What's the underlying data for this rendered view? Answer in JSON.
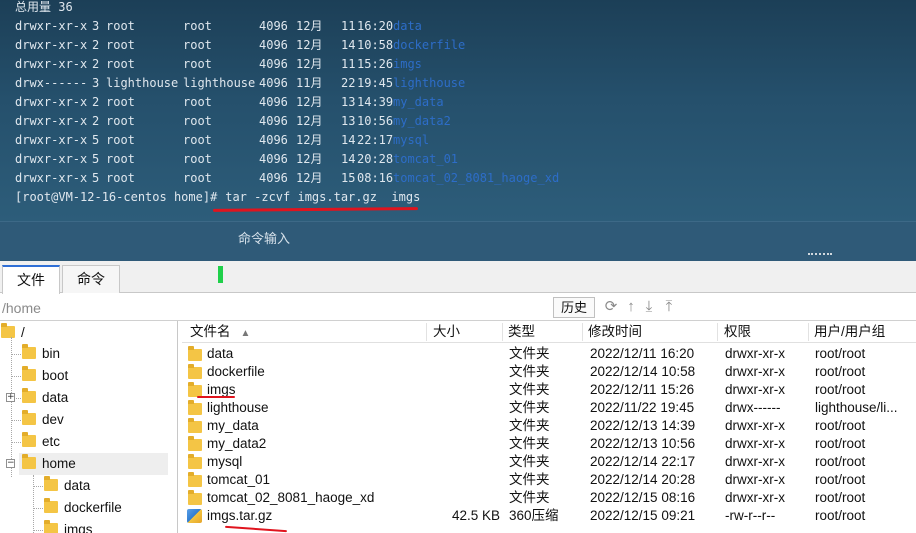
{
  "terminal": {
    "total_line": "总用量 36",
    "rows": [
      {
        "perm": "drwxr-xr-x",
        "links": "3",
        "owner": "root",
        "group": "root",
        "size": "4096",
        "month": "12月",
        "day": "11",
        "time": "16:20",
        "name": "data"
      },
      {
        "perm": "drwxr-xr-x",
        "links": "2",
        "owner": "root",
        "group": "root",
        "size": "4096",
        "month": "12月",
        "day": "14",
        "time": "10:58",
        "name": "dockerfile"
      },
      {
        "perm": "drwxr-xr-x",
        "links": "2",
        "owner": "root",
        "group": "root",
        "size": "4096",
        "month": "12月",
        "day": "11",
        "time": "15:26",
        "name": "imgs"
      },
      {
        "perm": "drwx------",
        "links": "3",
        "owner": "lighthouse",
        "group": "lighthouse",
        "size": "4096",
        "month": "11月",
        "day": "22",
        "time": "19:45",
        "name": "lighthouse"
      },
      {
        "perm": "drwxr-xr-x",
        "links": "2",
        "owner": "root",
        "group": "root",
        "size": "4096",
        "month": "12月",
        "day": "13",
        "time": "14:39",
        "name": "my_data"
      },
      {
        "perm": "drwxr-xr-x",
        "links": "2",
        "owner": "root",
        "group": "root",
        "size": "4096",
        "month": "12月",
        "day": "13",
        "time": "10:56",
        "name": "my_data2"
      },
      {
        "perm": "drwxr-xr-x",
        "links": "5",
        "owner": "root",
        "group": "root",
        "size": "4096",
        "month": "12月",
        "day": "14",
        "time": "22:17",
        "name": "mysql"
      },
      {
        "perm": "drwxr-xr-x",
        "links": "5",
        "owner": "root",
        "group": "root",
        "size": "4096",
        "month": "12月",
        "day": "14",
        "time": "20:28",
        "name": "tomcat_01"
      },
      {
        "perm": "drwxr-xr-x",
        "links": "5",
        "owner": "root",
        "group": "root",
        "size": "4096",
        "month": "12月",
        "day": "15",
        "time": "08:16",
        "name": "tomcat_02_8081_haoge_xd"
      }
    ],
    "prompt": "[root@VM-12-16-centos home]#",
    "command": " tar -zcvf imgs.tar.gz  imgs",
    "command_input_label": "命令输入"
  },
  "file_manager": {
    "tabs": [
      {
        "label": "文件",
        "active": true
      },
      {
        "label": "命令",
        "active": false
      }
    ],
    "path_value": "/home",
    "history_label": "历史",
    "toolbar_icons": [
      "refresh-icon",
      "up-arrow-icon",
      "download-icon",
      "upload-icon"
    ],
    "tree": {
      "root_label": "/",
      "items": [
        {
          "label": "bin",
          "expandable": false
        },
        {
          "label": "boot",
          "expandable": false
        },
        {
          "label": "data",
          "expandable": true
        },
        {
          "label": "dev",
          "expandable": false
        },
        {
          "label": "etc",
          "expandable": false
        },
        {
          "label": "home",
          "expandable": true,
          "expanded": true,
          "selected": true
        }
      ],
      "children": [
        {
          "label": "data"
        },
        {
          "label": "dockerfile"
        },
        {
          "label": "imgs"
        }
      ]
    },
    "columns": {
      "name": "文件名",
      "size": "大小",
      "type": "类型",
      "modified": "修改时间",
      "perm": "权限",
      "owner": "用户/用户组"
    },
    "rows": [
      {
        "name": "data",
        "size": "",
        "type": "文件夹",
        "modified": "2022/12/11 16:20",
        "perm": "drwxr-xr-x",
        "owner": "root/root",
        "kind": "folder"
      },
      {
        "name": "dockerfile",
        "size": "",
        "type": "文件夹",
        "modified": "2022/12/14 10:58",
        "perm": "drwxr-xr-x",
        "owner": "root/root",
        "kind": "folder"
      },
      {
        "name": "imgs",
        "size": "",
        "type": "文件夹",
        "modified": "2022/12/11 15:26",
        "perm": "drwxr-xr-x",
        "owner": "root/root",
        "kind": "folder"
      },
      {
        "name": "lighthouse",
        "size": "",
        "type": "文件夹",
        "modified": "2022/11/22 19:45",
        "perm": "drwx------",
        "owner": "lighthouse/li...",
        "kind": "folder"
      },
      {
        "name": "my_data",
        "size": "",
        "type": "文件夹",
        "modified": "2022/12/13 14:39",
        "perm": "drwxr-xr-x",
        "owner": "root/root",
        "kind": "folder"
      },
      {
        "name": "my_data2",
        "size": "",
        "type": "文件夹",
        "modified": "2022/12/13 10:56",
        "perm": "drwxr-xr-x",
        "owner": "root/root",
        "kind": "folder"
      },
      {
        "name": "mysql",
        "size": "",
        "type": "文件夹",
        "modified": "2022/12/14 22:17",
        "perm": "drwxr-xr-x",
        "owner": "root/root",
        "kind": "folder"
      },
      {
        "name": "tomcat_01",
        "size": "",
        "type": "文件夹",
        "modified": "2022/12/14 20:28",
        "perm": "drwxr-xr-x",
        "owner": "root/root",
        "kind": "folder"
      },
      {
        "name": "tomcat_02_8081_haoge_xd",
        "size": "",
        "type": "文件夹",
        "modified": "2022/12/15 08:16",
        "perm": "drwxr-xr-x",
        "owner": "root/root",
        "kind": "folder"
      },
      {
        "name": "imgs.tar.gz",
        "size": "42.5 KB",
        "type": "360压缩",
        "modified": "2022/12/15 09:21",
        "perm": "-rw-r--r--",
        "owner": "root/root",
        "kind": "archive"
      }
    ]
  },
  "colors": {
    "terminal_bg": "#25506c",
    "dir_name_blue": "#2d6dc8",
    "annotation_red": "#e0141e",
    "status_green": "#1fd04a",
    "tab_accent": "#2f6fd6"
  }
}
